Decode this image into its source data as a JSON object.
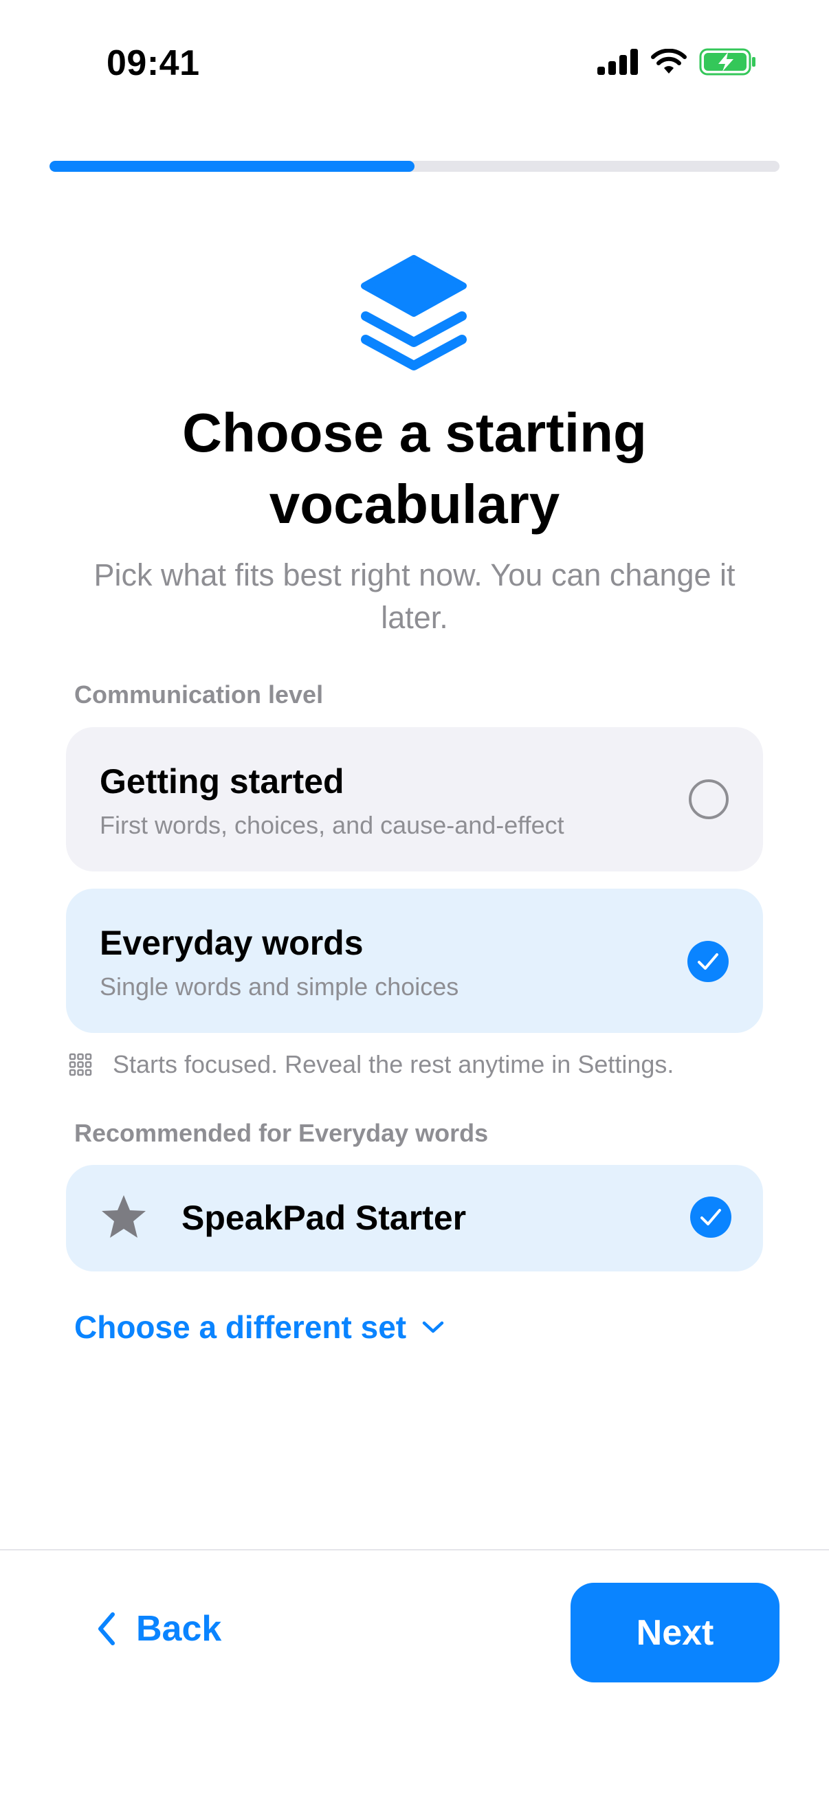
{
  "status_bar": {
    "time": "09:41"
  },
  "progress": {
    "fraction": 0.5
  },
  "header": {
    "icon": "stack-layers-icon",
    "title": "Choose a starting vocabulary",
    "subtitle": "Pick what fits best right now. You can change it later."
  },
  "communication": {
    "section_label": "Communication level",
    "options": [
      {
        "title": "Getting started",
        "description": "First words, choices, and cause-and-effect",
        "selected": false
      },
      {
        "title": "Everyday words",
        "description": "Single words and simple choices",
        "selected": true
      }
    ],
    "hint_icon": "grid-icon",
    "hint": "Starts focused. Reveal the rest anytime in Settings."
  },
  "recommended": {
    "section_label": "Recommended for Everyday words",
    "item": {
      "icon": "star-icon",
      "title": "SpeakPad Starter",
      "selected": true
    },
    "choose_different_label": "Choose a different set"
  },
  "footer": {
    "back_label": "Back",
    "next_label": "Next"
  },
  "colors": {
    "accent": "#0a84ff",
    "selected_card": "#e4f1fd",
    "unselected_card": "#f2f2f7",
    "secondary_text": "#8e8e93"
  }
}
